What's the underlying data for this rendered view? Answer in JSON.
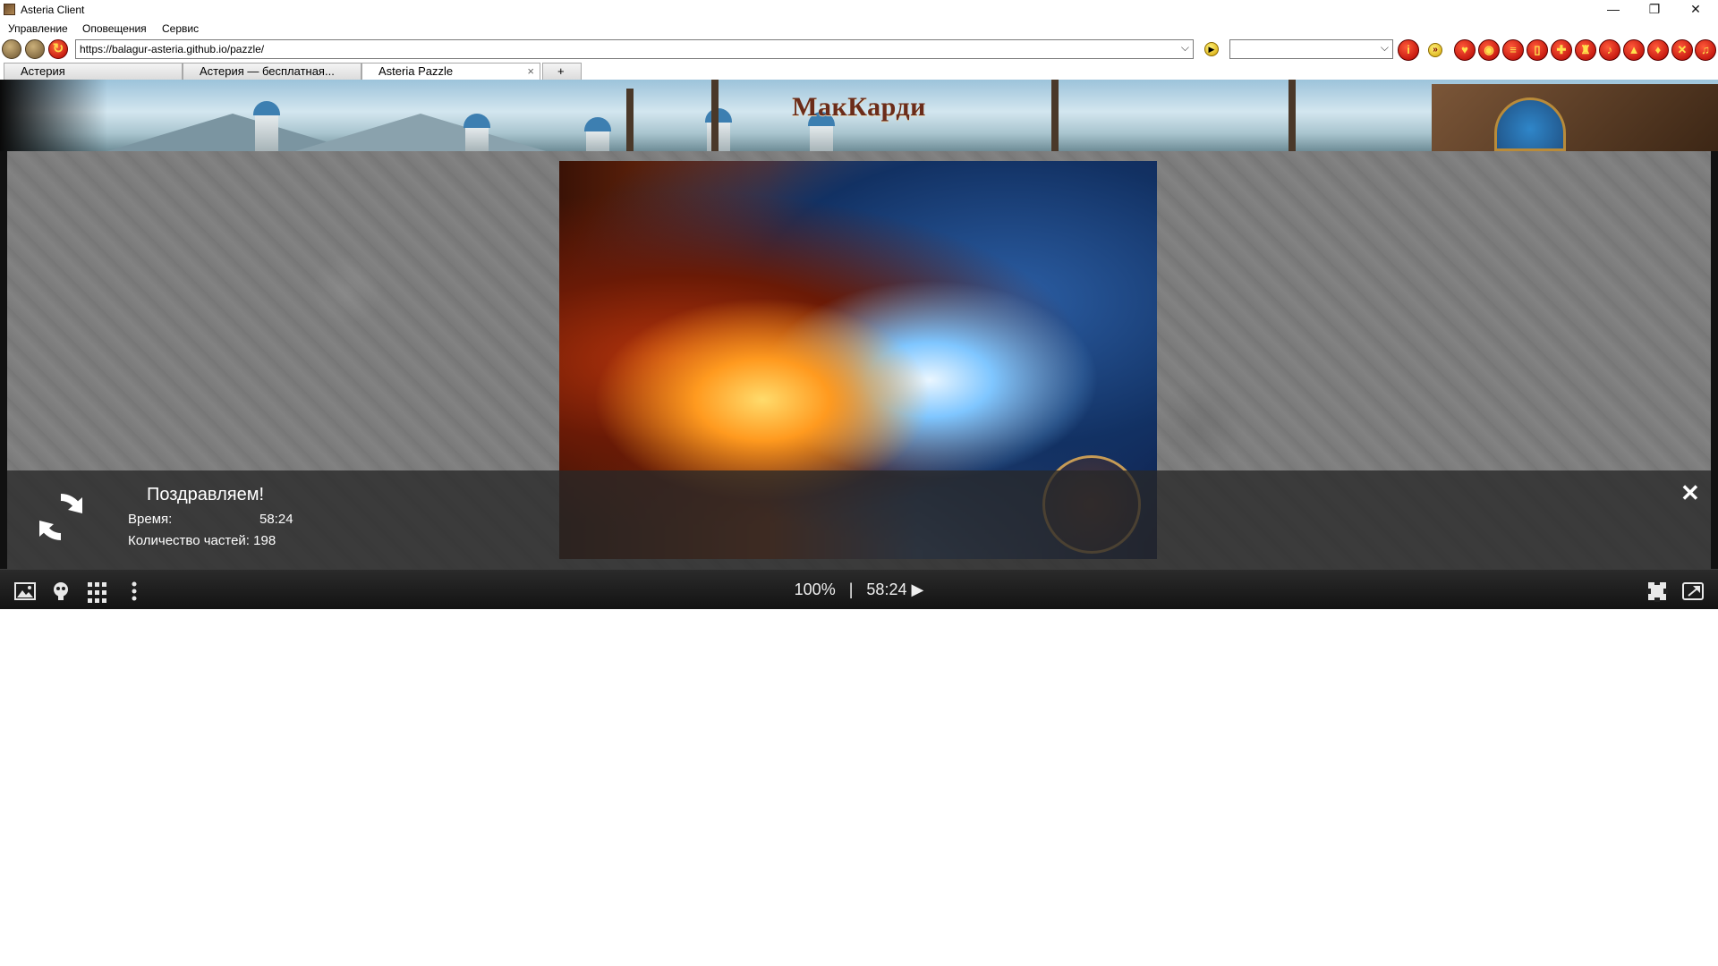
{
  "window": {
    "title": "Asteria Client",
    "minimize": "—",
    "restore": "❐",
    "close": "✕"
  },
  "menu": {
    "items": [
      "Управление",
      "Оповещения",
      "Сервис"
    ]
  },
  "toolbar": {
    "url": "https://balagur-asteria.github.io/pazzle/",
    "dropdown_arrow": "⌵",
    "select_value": "",
    "icons": [
      "back-icon",
      "forward-icon",
      "reload-icon",
      "go-icon",
      "info-icon",
      "arrow-icon",
      "heart-icon",
      "camera-icon",
      "scroll-icon",
      "book-icon",
      "gift-icon",
      "lamp-icon",
      "bell-icon",
      "shirt-icon",
      "potion-icon",
      "swords-icon",
      "music-icon"
    ]
  },
  "tabs": [
    {
      "label": "Астерия",
      "active": false
    },
    {
      "label": "Астерия — бесплатная...",
      "active": false
    },
    {
      "label": "Asteria Pazzle",
      "active": true,
      "close": "×"
    },
    {
      "label": "+",
      "active": false
    }
  ],
  "banner": {
    "title": "МакКарди"
  },
  "result": {
    "congrats": "Поздравляем!",
    "time_label": "Время:",
    "time_value": "58:24",
    "parts_label": "Количество частей: 198",
    "close": "✕"
  },
  "statusbar": {
    "zoom": "100%",
    "separator": "|",
    "timer": "58:24",
    "play": "▶"
  },
  "colors": {
    "accent_red": "#b10000",
    "banner_title": "#6b2c1a",
    "overlay": "#282828"
  }
}
